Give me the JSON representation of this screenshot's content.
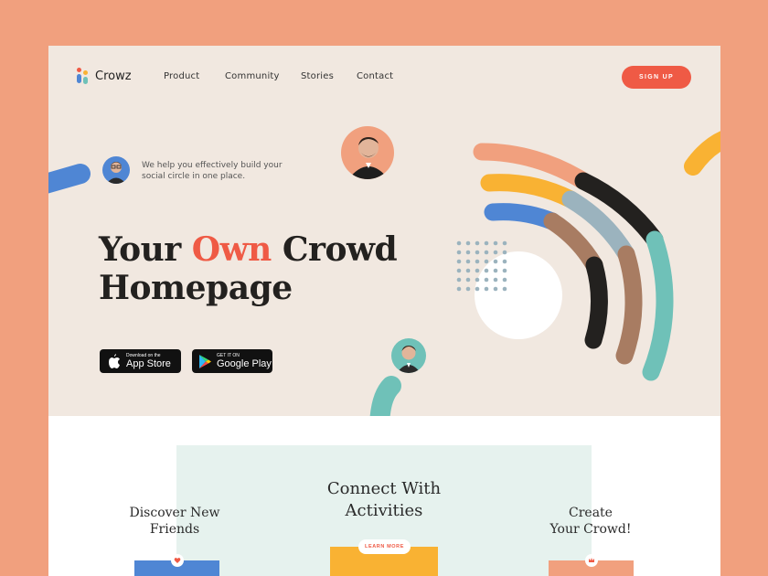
{
  "brand": {
    "name": "Crowz"
  },
  "nav": {
    "items": [
      "Product",
      "Community",
      "Stories",
      "Contact"
    ],
    "signup_label": "SIGN UP"
  },
  "hero": {
    "tagline": "We help you effectively build your social circle in one place.",
    "headline": {
      "part1": "Your ",
      "accent": "Own",
      "part2": " Crowd",
      "line2": "Homepage"
    },
    "app_store": {
      "small": "Download on the",
      "big": "App Store"
    },
    "google_play": {
      "small": "GET IT ON",
      "big": "Google Play"
    }
  },
  "features": {
    "left": {
      "line1": "Discover New",
      "line2": "Friends"
    },
    "center": {
      "line1": "Connect With",
      "line2": "Activities",
      "button": "LEARN MORE"
    },
    "right": {
      "line1": "Create",
      "line2": "Your Crowd!"
    }
  },
  "colors": {
    "background": "#F1A07E",
    "hero": "#F1E8E0",
    "accent": "#EF5A45",
    "blue": "#4F86D4",
    "yellow": "#F9B233",
    "teal": "#6FC1B8",
    "brown": "#A87C62",
    "dark": "#23211F",
    "salmon": "#F1A07E",
    "slate": "#9BB3BE"
  },
  "icons": [
    "logo-icon",
    "apple-icon",
    "google-play-icon",
    "heart-icon",
    "crown-icon"
  ]
}
